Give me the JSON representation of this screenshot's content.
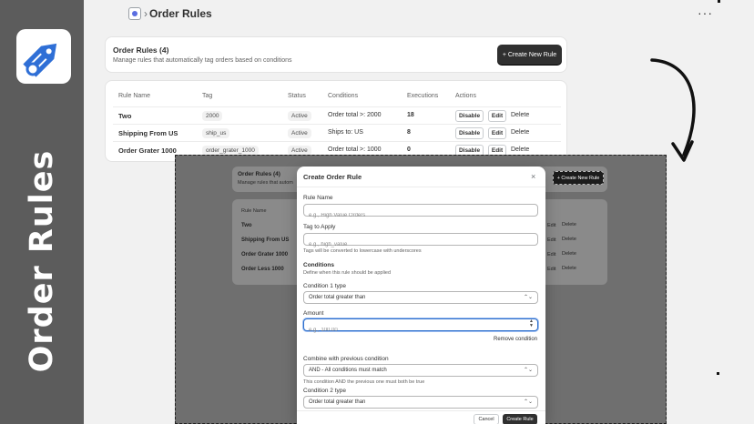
{
  "promo": {
    "title": "Order Rules",
    "logo_icon": "tag-icon"
  },
  "header": {
    "chevron": "›",
    "title": "Order Rules",
    "more": "···"
  },
  "summary": {
    "title": "Order Rules (4)",
    "subtitle": "Manage rules that automatically tag orders based on conditions",
    "create_button": "+ Create New Rule"
  },
  "table": {
    "columns": [
      "Rule Name",
      "Tag",
      "Status",
      "Conditions",
      "Executions",
      "Actions"
    ],
    "rows": [
      {
        "name": "Two",
        "tag": "2000",
        "status": "Active",
        "conditions": "Order total >: 2000",
        "executions": "18"
      },
      {
        "name": "Shipping From US",
        "tag": "ship_us",
        "status": "Active",
        "conditions": "Ships to: US",
        "executions": "8"
      },
      {
        "name": "Order Grater 1000",
        "tag": "order_grater_1000",
        "status": "Active",
        "conditions": "Order total >: 1000",
        "executions": "0"
      }
    ],
    "actions": {
      "disable": "Disable",
      "edit": "Edit",
      "delete": "Delete"
    }
  },
  "background": {
    "title": "Order Rules (4)",
    "subtitle": "Manage rules that autom",
    "create_button": "+ Create New Rule",
    "column": "Rule Name",
    "rows": [
      "Two",
      "Shipping From US",
      "Order Grater 1000",
      "Order Less 1000"
    ]
  },
  "modal": {
    "title": "Create Order Rule",
    "close": "×",
    "rule_name_label": "Rule Name",
    "rule_name_placeholder": "e.g., High Value Orders",
    "tag_label": "Tag to Apply",
    "tag_placeholder": "e.g., high_value",
    "tag_hint": "Tags will be converted to lowercase with underscores",
    "conditions_label": "Conditions",
    "conditions_hint": "Define when this rule should be applied",
    "cond1_label": "Condition 1 type",
    "cond1_value": "Order total greater than",
    "amount_label": "Amount",
    "amount_placeholder": "e.g., 100.00",
    "remove_condition": "Remove condition",
    "combine_label": "Combine with previous condition",
    "combine_value": "AND - All conditions must match",
    "combine_hint": "This condition AND the previous one must both be true",
    "cond2_label": "Condition 2 type",
    "cond2_value": "Order total greater than",
    "cancel": "Cancel",
    "create": "Create Rule"
  }
}
